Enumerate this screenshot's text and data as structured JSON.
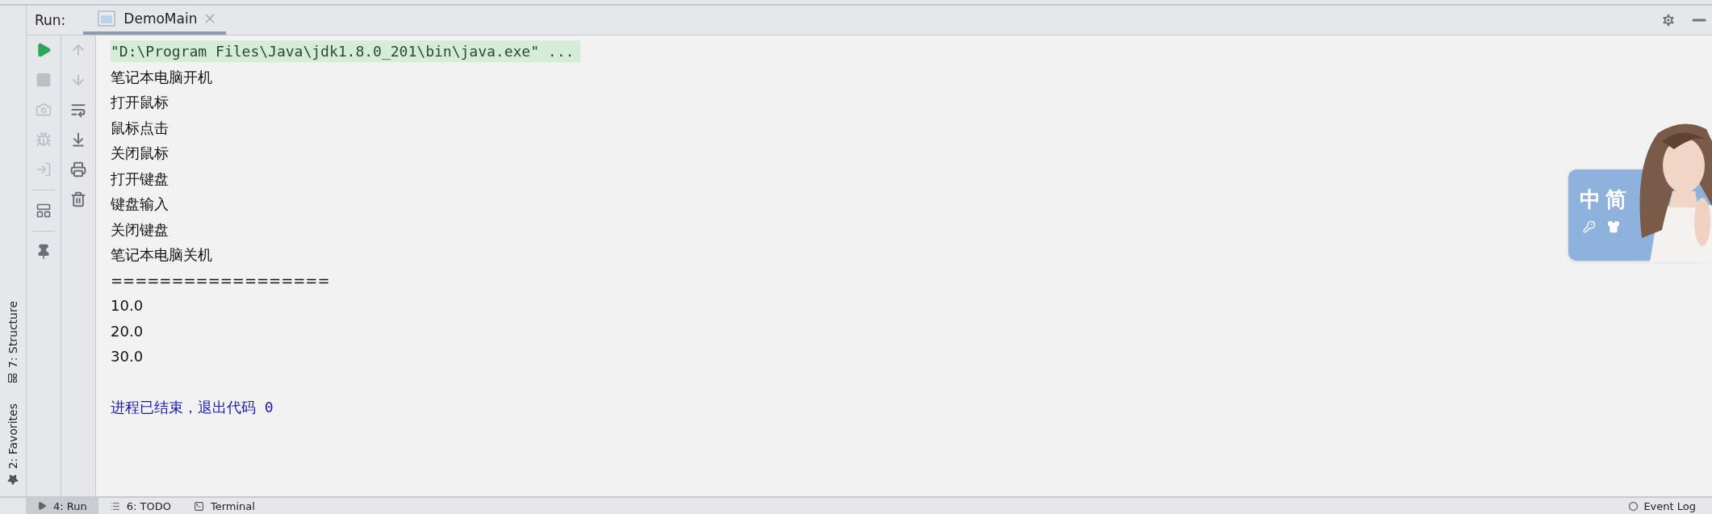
{
  "run_header": {
    "label": "Run:",
    "tabs": [
      {
        "label": "DemoMain",
        "selected": true
      }
    ]
  },
  "side_stripe": {
    "items": [
      "7: Structure",
      "2: Favorites"
    ]
  },
  "toolbar_main": [
    {
      "disabled": false
    },
    {
      "disabled": true
    },
    {
      "disabled": true
    },
    {
      "disabled": true
    },
    {
      "disabled": true
    },
    {
      "disabled": false
    },
    {
      "disabled": false
    }
  ],
  "toolbar_output": [
    {
      "disabled": true
    },
    {
      "disabled": true
    },
    {
      "disabled": false
    },
    {
      "disabled": false
    },
    {
      "disabled": false
    },
    {
      "disabled": false
    }
  ],
  "console": {
    "lines": [
      {
        "kind": "command",
        "text": "\"D:\\Program Files\\Java\\jdk1.8.0_201\\bin\\java.exe\" ..."
      },
      {
        "kind": "output",
        "text": "笔记本电脑开机"
      },
      {
        "kind": "output",
        "text": "打开鼠标"
      },
      {
        "kind": "output",
        "text": "鼠标点击"
      },
      {
        "kind": "output",
        "text": "关闭鼠标"
      },
      {
        "kind": "output",
        "text": "打开键盘"
      },
      {
        "kind": "output",
        "text": "键盘输入"
      },
      {
        "kind": "output",
        "text": "关闭键盘"
      },
      {
        "kind": "output",
        "text": "笔记本电脑关机"
      },
      {
        "kind": "output",
        "text": "=================="
      },
      {
        "kind": "output",
        "text": "10.0"
      },
      {
        "kind": "output",
        "text": "20.0"
      },
      {
        "kind": "output",
        "text": "30.0"
      },
      {
        "kind": "exit",
        "text": "进程已结束，退出代码 0"
      }
    ]
  },
  "ime_widget": {
    "labels": [
      "中",
      "简"
    ],
    "kind": "picture"
  },
  "bottom_bar": {
    "tabs": [
      {
        "label": "4: Run",
        "selected": true
      },
      {
        "label": "6: TODO",
        "selected": false
      },
      {
        "label": "Terminal",
        "selected": false
      }
    ],
    "event_log": "Event Log"
  }
}
